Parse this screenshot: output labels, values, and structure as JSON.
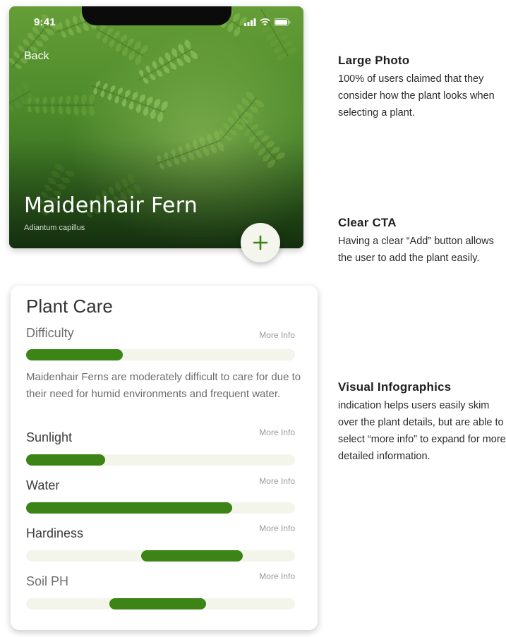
{
  "status_bar": {
    "time": "9:41"
  },
  "hero": {
    "back_label": "Back",
    "title": "Maidenhair Fern",
    "scientific_name": "Adiantum capillus",
    "add_icon": "plus-icon"
  },
  "care": {
    "title": "Plant Care",
    "more_info_label": "More Info",
    "description": "Maidenhair Ferns are moderately difficult to care for due to their need for humid environments and frequent water.",
    "accent_color": "#3c8415",
    "track_color": "#f3f5ea",
    "sections": [
      {
        "label": "Difficulty",
        "range": [
          0.0,
          0.36
        ]
      },
      {
        "label": "Sunlight",
        "range": [
          0.0,
          0.295
        ]
      },
      {
        "label": "Water",
        "range": [
          0.0,
          0.767
        ]
      },
      {
        "label": "Hardiness",
        "range": [
          0.427,
          0.805
        ]
      },
      {
        "label": "Soil PH",
        "range": [
          0.31,
          0.67
        ]
      }
    ]
  },
  "annotations": [
    {
      "title": "Large Photo",
      "body": "100% of users claimed that they consider how the plant looks when selecting a plant."
    },
    {
      "title": "Clear CTA",
      "body": "Having a clear “Add” button allows the user to add the plant easily."
    },
    {
      "title": "Visual Infographics",
      "body": "indication helps users easily skim over the plant details, but are able to select “more info” to expand for more detailed information."
    }
  ]
}
